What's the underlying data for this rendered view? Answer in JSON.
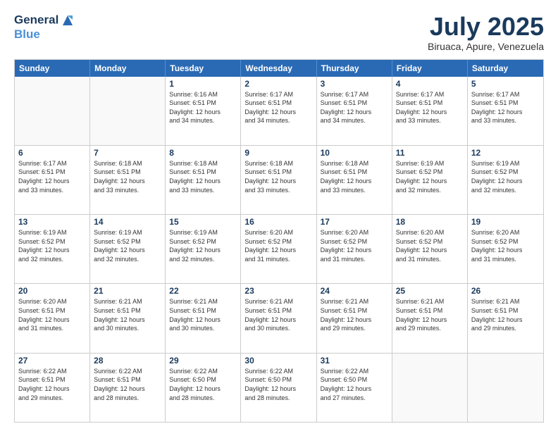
{
  "header": {
    "logo_line1": "General",
    "logo_line2": "Blue",
    "month": "July 2025",
    "location": "Biruaca, Apure, Venezuela"
  },
  "calendar": {
    "days_of_week": [
      "Sunday",
      "Monday",
      "Tuesday",
      "Wednesday",
      "Thursday",
      "Friday",
      "Saturday"
    ],
    "weeks": [
      [
        {
          "day": "",
          "info": ""
        },
        {
          "day": "",
          "info": ""
        },
        {
          "day": "1",
          "info": "Sunrise: 6:16 AM\nSunset: 6:51 PM\nDaylight: 12 hours\nand 34 minutes."
        },
        {
          "day": "2",
          "info": "Sunrise: 6:17 AM\nSunset: 6:51 PM\nDaylight: 12 hours\nand 34 minutes."
        },
        {
          "day": "3",
          "info": "Sunrise: 6:17 AM\nSunset: 6:51 PM\nDaylight: 12 hours\nand 34 minutes."
        },
        {
          "day": "4",
          "info": "Sunrise: 6:17 AM\nSunset: 6:51 PM\nDaylight: 12 hours\nand 33 minutes."
        },
        {
          "day": "5",
          "info": "Sunrise: 6:17 AM\nSunset: 6:51 PM\nDaylight: 12 hours\nand 33 minutes."
        }
      ],
      [
        {
          "day": "6",
          "info": "Sunrise: 6:17 AM\nSunset: 6:51 PM\nDaylight: 12 hours\nand 33 minutes."
        },
        {
          "day": "7",
          "info": "Sunrise: 6:18 AM\nSunset: 6:51 PM\nDaylight: 12 hours\nand 33 minutes."
        },
        {
          "day": "8",
          "info": "Sunrise: 6:18 AM\nSunset: 6:51 PM\nDaylight: 12 hours\nand 33 minutes."
        },
        {
          "day": "9",
          "info": "Sunrise: 6:18 AM\nSunset: 6:51 PM\nDaylight: 12 hours\nand 33 minutes."
        },
        {
          "day": "10",
          "info": "Sunrise: 6:18 AM\nSunset: 6:51 PM\nDaylight: 12 hours\nand 33 minutes."
        },
        {
          "day": "11",
          "info": "Sunrise: 6:19 AM\nSunset: 6:52 PM\nDaylight: 12 hours\nand 32 minutes."
        },
        {
          "day": "12",
          "info": "Sunrise: 6:19 AM\nSunset: 6:52 PM\nDaylight: 12 hours\nand 32 minutes."
        }
      ],
      [
        {
          "day": "13",
          "info": "Sunrise: 6:19 AM\nSunset: 6:52 PM\nDaylight: 12 hours\nand 32 minutes."
        },
        {
          "day": "14",
          "info": "Sunrise: 6:19 AM\nSunset: 6:52 PM\nDaylight: 12 hours\nand 32 minutes."
        },
        {
          "day": "15",
          "info": "Sunrise: 6:19 AM\nSunset: 6:52 PM\nDaylight: 12 hours\nand 32 minutes."
        },
        {
          "day": "16",
          "info": "Sunrise: 6:20 AM\nSunset: 6:52 PM\nDaylight: 12 hours\nand 31 minutes."
        },
        {
          "day": "17",
          "info": "Sunrise: 6:20 AM\nSunset: 6:52 PM\nDaylight: 12 hours\nand 31 minutes."
        },
        {
          "day": "18",
          "info": "Sunrise: 6:20 AM\nSunset: 6:52 PM\nDaylight: 12 hours\nand 31 minutes."
        },
        {
          "day": "19",
          "info": "Sunrise: 6:20 AM\nSunset: 6:52 PM\nDaylight: 12 hours\nand 31 minutes."
        }
      ],
      [
        {
          "day": "20",
          "info": "Sunrise: 6:20 AM\nSunset: 6:51 PM\nDaylight: 12 hours\nand 31 minutes."
        },
        {
          "day": "21",
          "info": "Sunrise: 6:21 AM\nSunset: 6:51 PM\nDaylight: 12 hours\nand 30 minutes."
        },
        {
          "day": "22",
          "info": "Sunrise: 6:21 AM\nSunset: 6:51 PM\nDaylight: 12 hours\nand 30 minutes."
        },
        {
          "day": "23",
          "info": "Sunrise: 6:21 AM\nSunset: 6:51 PM\nDaylight: 12 hours\nand 30 minutes."
        },
        {
          "day": "24",
          "info": "Sunrise: 6:21 AM\nSunset: 6:51 PM\nDaylight: 12 hours\nand 29 minutes."
        },
        {
          "day": "25",
          "info": "Sunrise: 6:21 AM\nSunset: 6:51 PM\nDaylight: 12 hours\nand 29 minutes."
        },
        {
          "day": "26",
          "info": "Sunrise: 6:21 AM\nSunset: 6:51 PM\nDaylight: 12 hours\nand 29 minutes."
        }
      ],
      [
        {
          "day": "27",
          "info": "Sunrise: 6:22 AM\nSunset: 6:51 PM\nDaylight: 12 hours\nand 29 minutes."
        },
        {
          "day": "28",
          "info": "Sunrise: 6:22 AM\nSunset: 6:51 PM\nDaylight: 12 hours\nand 28 minutes."
        },
        {
          "day": "29",
          "info": "Sunrise: 6:22 AM\nSunset: 6:50 PM\nDaylight: 12 hours\nand 28 minutes."
        },
        {
          "day": "30",
          "info": "Sunrise: 6:22 AM\nSunset: 6:50 PM\nDaylight: 12 hours\nand 28 minutes."
        },
        {
          "day": "31",
          "info": "Sunrise: 6:22 AM\nSunset: 6:50 PM\nDaylight: 12 hours\nand 27 minutes."
        },
        {
          "day": "",
          "info": ""
        },
        {
          "day": "",
          "info": ""
        }
      ]
    ]
  }
}
